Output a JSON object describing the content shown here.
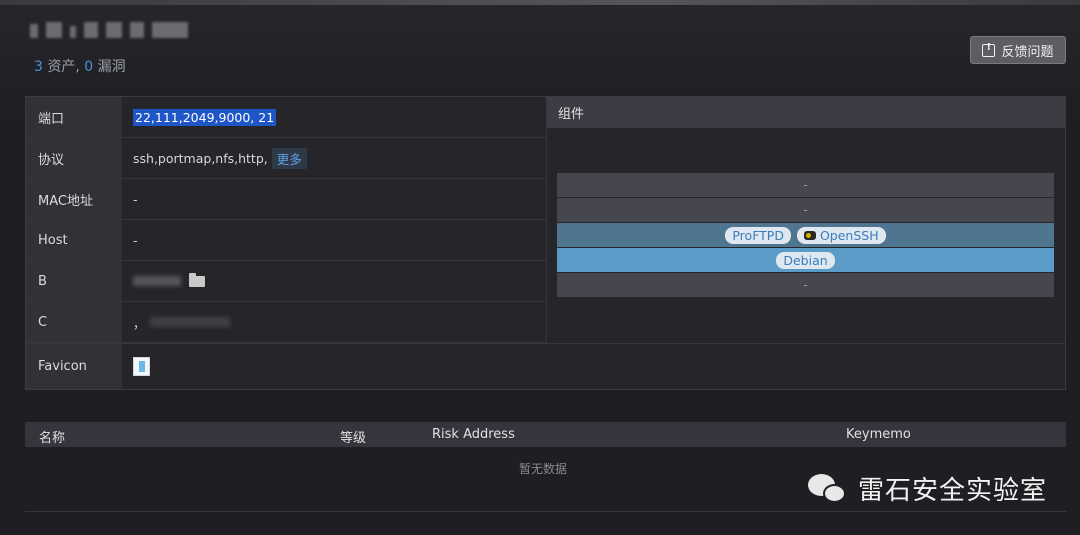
{
  "summary": {
    "assets_count": "3",
    "assets_label": " 资产, ",
    "vulns_count": "0",
    "vulns_label": " 漏洞"
  },
  "feedback": {
    "label": "反馈问题"
  },
  "info": {
    "rows": [
      {
        "label": "端口",
        "value": "22,111,2049,9000, 21"
      },
      {
        "label": "协议",
        "value": "ssh,portmap,nfs,http,",
        "more": "更多"
      },
      {
        "label": "MAC地址",
        "value": "-"
      },
      {
        "label": "Host",
        "value": "-"
      },
      {
        "label": "B",
        "value": ""
      },
      {
        "label": "C",
        "value": "，"
      },
      {
        "label": "Favicon",
        "value": ""
      }
    ]
  },
  "components": {
    "header": "组件",
    "bars": [
      {
        "text": "-"
      },
      {
        "text": "-"
      },
      {
        "pills": [
          "ProFTPD",
          "OpenSSH"
        ]
      },
      {
        "pills": [
          "Debian"
        ]
      },
      {
        "text": "-"
      }
    ]
  },
  "risk_table": {
    "columns": [
      "名称",
      "等级",
      "Risk Address",
      "Keymemo"
    ],
    "empty": "暂无数据"
  },
  "watermark": {
    "text": "雷石安全实验室"
  },
  "colors": {
    "accent": "#4a90d9",
    "highlight": "#1e56c8",
    "bar_active": "#5a9bc7"
  }
}
